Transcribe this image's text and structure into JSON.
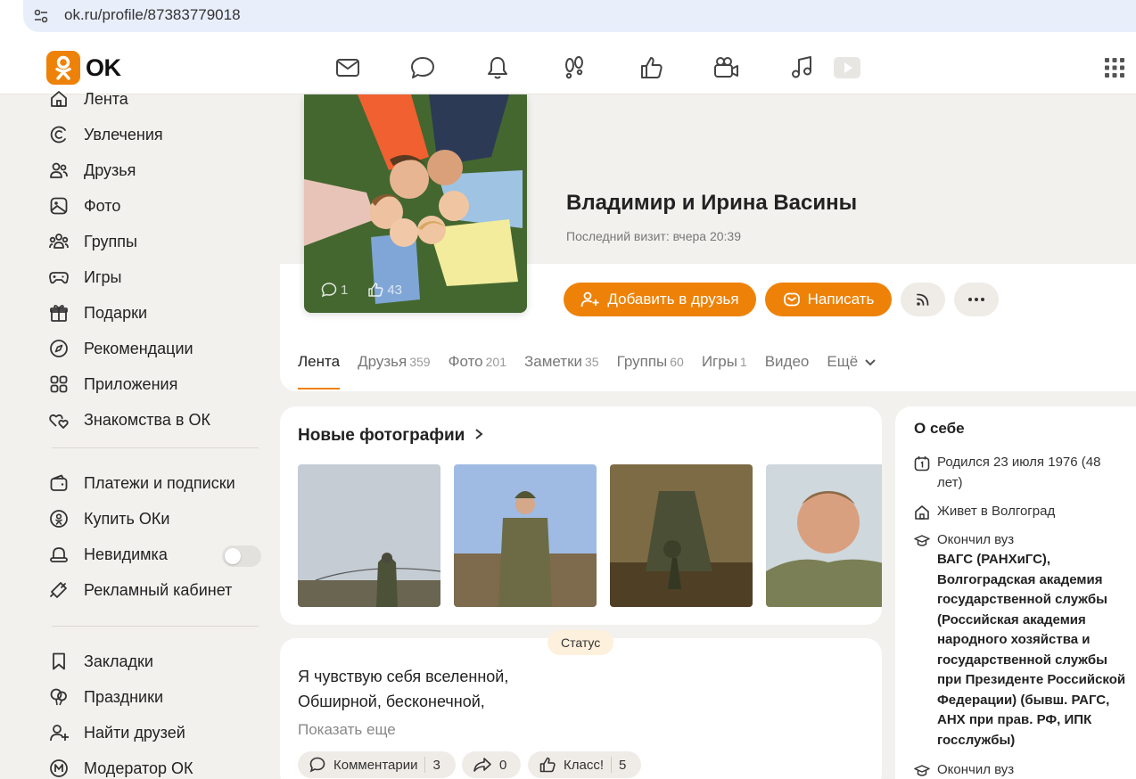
{
  "browser": {
    "url": "ok.ru/profile/87383779018"
  },
  "header": {
    "logo_text": "OK",
    "accent_color": "#ee8208",
    "nav_icons": [
      "mail-icon",
      "chat-icon",
      "bell-icon",
      "guests-icon",
      "likes-icon",
      "video-camera-icon",
      "music-icon",
      "video-icon"
    ]
  },
  "sidebar": {
    "items": [
      {
        "label": "Лента",
        "icon": "home-icon"
      },
      {
        "label": "Увлечения",
        "icon": "hobby-icon"
      },
      {
        "label": "Друзья",
        "icon": "friends-icon"
      },
      {
        "label": "Фото",
        "icon": "photo-icon"
      },
      {
        "label": "Группы",
        "icon": "groups-icon"
      },
      {
        "label": "Игры",
        "icon": "gamepad-icon"
      },
      {
        "label": "Подарки",
        "icon": "gift-icon"
      },
      {
        "label": "Рекомендации",
        "icon": "compass-icon"
      },
      {
        "label": "Приложения",
        "icon": "apps-icon"
      },
      {
        "label": "Знакомства в ОК",
        "icon": "hearts-icon"
      }
    ],
    "items2": [
      {
        "label": "Платежи и подписки",
        "icon": "wallet-icon"
      },
      {
        "label": "Купить ОКи",
        "icon": "coin-icon"
      },
      {
        "label": "Невидимка",
        "icon": "invisible-icon"
      },
      {
        "label": "Рекламный кабинет",
        "icon": "megaphone-icon"
      }
    ],
    "items3": [
      {
        "label": "Закладки",
        "icon": "bookmark-icon"
      },
      {
        "label": "Праздники",
        "icon": "balloons-icon"
      },
      {
        "label": "Найти друзей",
        "icon": "add-user-icon"
      },
      {
        "label": "Модератор ОК",
        "icon": "moderator-icon"
      }
    ]
  },
  "profile": {
    "name": "Владимир и Ирина Васины",
    "last_visit": "Последний визит: вчера 20:39",
    "avatar_comments": "1",
    "avatar_likes": "43",
    "add_friend_label": "Добавить в друзья",
    "message_label": "Написать"
  },
  "tabs": [
    {
      "label": "Лента",
      "count": ""
    },
    {
      "label": "Друзья",
      "count": "359"
    },
    {
      "label": "Фото",
      "count": "201"
    },
    {
      "label": "Заметки",
      "count": "35"
    },
    {
      "label": "Группы",
      "count": "60"
    },
    {
      "label": "Игры",
      "count": "1"
    },
    {
      "label": "Видео",
      "count": ""
    },
    {
      "label": "Ещё",
      "count": ""
    }
  ],
  "photos": {
    "title": "Новые фотографии"
  },
  "status": {
    "badge": "Статус",
    "line1": "Я чувствую себя вселенной,",
    "line2": "Обширной, бесконечной,",
    "show_more": "Показать еще",
    "comments_label": "Комментарии",
    "comments_count": "3",
    "shares_count": "0",
    "likes_label": "Класс!",
    "likes_count": "5"
  },
  "about": {
    "title": "О себе",
    "born": "Родился 23 июля 1976 (48 лет)",
    "lives": "Живет в Волгоград",
    "education_label": "Окончил вуз",
    "education_name": "ВАГС (РАНХиГС), Волгоградская академия государственной службы (Российская академия народного хозяйства и государственной службы при Президенте Российской Федерации) (бывш. РАГС, АНХ при прав. РФ, ИПК госслужбы)",
    "education_label2": "Окончил вуз"
  }
}
